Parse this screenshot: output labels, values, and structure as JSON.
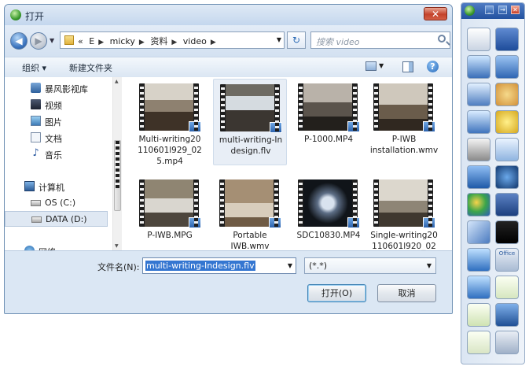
{
  "dialog": {
    "title": "打开",
    "close_label": "✕",
    "breadcrumb": [
      "«",
      "E",
      "micky",
      "资料",
      "video"
    ],
    "search_placeholder": "搜索 video",
    "toolbar": {
      "organize": "组织 ▾",
      "new_folder": "新建文件夹",
      "help": "?"
    },
    "nav_items": [
      {
        "label": "暴风影视库",
        "icon": "storm-library-icon"
      },
      {
        "label": "视频",
        "icon": "videos-library-icon"
      },
      {
        "label": "图片",
        "icon": "pictures-library-icon"
      },
      {
        "label": "文档",
        "icon": "documents-library-icon"
      },
      {
        "label": "音乐",
        "icon": "music-library-icon"
      },
      {
        "label": "计算机",
        "icon": "computer-icon"
      },
      {
        "label": "OS (C:)",
        "icon": "drive-c-icon"
      },
      {
        "label": "DATA (D:)",
        "icon": "drive-d-icon"
      },
      {
        "label": "网络",
        "icon": "network-icon"
      }
    ],
    "files": [
      {
        "name": "Multi-writing20110601l929_025.mp4",
        "display": [
          "Multi-writing20",
          "110601l929_02",
          "5.mp4"
        ]
      },
      {
        "name": "multi-writing-Indesign.flv",
        "display": [
          "multi-writing-In",
          "design.flv"
        ],
        "selected": true
      },
      {
        "name": "P-1000.MP4",
        "display": [
          "P-1000.MP4"
        ]
      },
      {
        "name": "P-IWB installation.wmv",
        "display": [
          "P-IWB",
          "installation.wmv"
        ]
      },
      {
        "name": "P-IWB.MPG",
        "display": [
          "P-IWB.MPG"
        ]
      },
      {
        "name": "Portable IWB.wmv",
        "display": [
          "Portable",
          "IWB.wmv"
        ]
      },
      {
        "name": "SDC10830.MP4",
        "display": [
          "SDC10830.MP4"
        ]
      },
      {
        "name": "Single-writing20110601l920_02",
        "display": [
          "Single-writing20",
          "110601l920_02"
        ]
      }
    ],
    "filename_label": "文件名(N):",
    "filename_value": "multi-writing-Indesign.flv",
    "filetype_value": "(*.*)",
    "open_button": "打开(O)",
    "cancel_button": "取消"
  },
  "toolbox": {
    "controls": [
      "_",
      "→",
      "✕"
    ],
    "tools": [
      "mouse-icon",
      "window-icon",
      "pen-icon",
      "lines-icon",
      "brush-icon",
      "palette-icon",
      "highlighter-icon",
      "texture-icon",
      "eraser-icon",
      "magnifier-icon",
      "pointer-icon",
      "camera-icon",
      "shapes-icon",
      "screen-capture-icon",
      "fill-icon",
      "video-icon",
      "undo-icon",
      "office-icon",
      "redo-icon",
      "blank-page-icon",
      "add-page-icon",
      "background-icon",
      "delete-page-icon",
      "save-icon"
    ],
    "office_label": "Office"
  }
}
